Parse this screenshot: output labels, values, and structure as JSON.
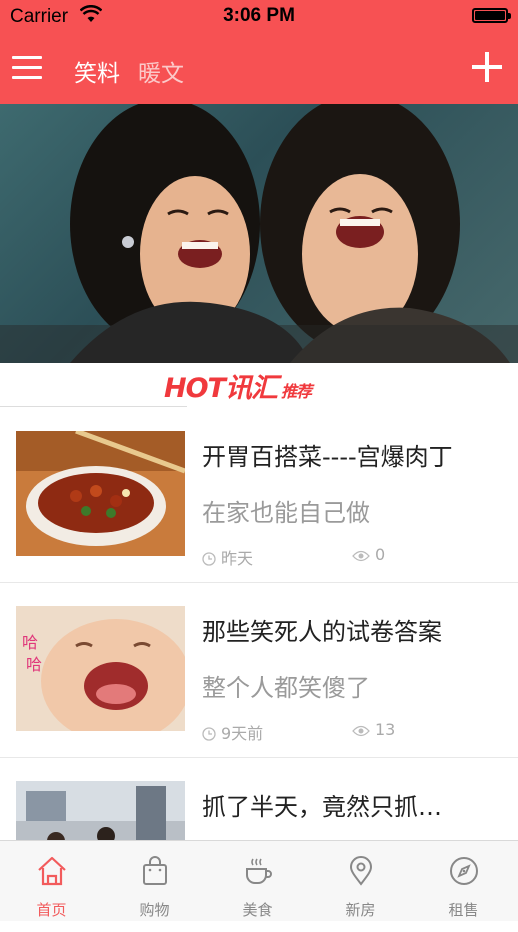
{
  "status_bar": {
    "carrier": "Carrier",
    "time": "3:06 PM"
  },
  "nav": {
    "tabs": [
      {
        "label": "笑料",
        "active": true
      },
      {
        "label": "暖文",
        "active": false
      }
    ]
  },
  "banner": {
    "image": "two-laughing-women-photo"
  },
  "hot": {
    "logo": "HOT讯汇",
    "sub": "推荐"
  },
  "items": [
    {
      "title": "开胃百搭菜----宫爆肉丁",
      "subtitle": "在家也能自己做",
      "time": "昨天",
      "views": "0",
      "thumb": "kung-pao-dish-photo"
    },
    {
      "title": "那些笑死人的试卷答案",
      "subtitle": "整个人都笑傻了",
      "time": "9天前",
      "views": "13",
      "thumb": "laughing-baby-photo"
    },
    {
      "title": "抓了半天，竟然只抓…",
      "subtitle": "",
      "time": "",
      "views": "",
      "thumb": "street-crowd-photo"
    }
  ],
  "tabbar": {
    "items": [
      {
        "label": "首页",
        "icon": "home-icon",
        "active": true
      },
      {
        "label": "购物",
        "icon": "shopping-bag-icon",
        "active": false
      },
      {
        "label": "美食",
        "icon": "coffee-cup-icon",
        "active": false
      },
      {
        "label": "新房",
        "icon": "location-pin-icon",
        "active": false
      },
      {
        "label": "租售",
        "icon": "compass-icon",
        "active": false
      }
    ]
  },
  "colors": {
    "accent": "#f75153",
    "tab_active": "#f25b5c",
    "tab_inactive": "#888888"
  }
}
